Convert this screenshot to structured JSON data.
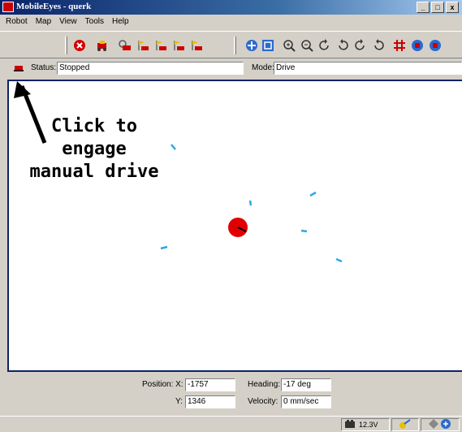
{
  "window": {
    "title": "MobileEyes - querk",
    "controls": [
      "_",
      "□",
      "x"
    ]
  },
  "menu": [
    "Robot",
    "Map",
    "View",
    "Tools",
    "Help"
  ],
  "toolbar": {
    "group1": [
      "stop-icon",
      "robot-drive-icon",
      "robot-goto-icon",
      "robot-goal-icon",
      "robot-goal-icon",
      "robot-goal-icon",
      "robot-goal-icon"
    ],
    "group2": [
      "center-icon",
      "zoom-fit-icon",
      "zoom-in-icon",
      "zoom-out-icon",
      "rotate-left-icon",
      "rotate-right-icon",
      "rotate-icon",
      "rotate-icon",
      "grid-icon",
      "robot-view-icon",
      "robot-view-icon"
    ]
  },
  "status": {
    "label": "Status:",
    "value": "Stopped",
    "mode_label": "Mode:",
    "mode_value": "Drive"
  },
  "annotation": {
    "lines": [
      "Click to",
      "engage",
      "manual drive"
    ]
  },
  "colors": {
    "robot": "#e00000",
    "laser_points": "#2aa9e6",
    "border": "#0a246a"
  },
  "position": {
    "x_label": "Position: X:",
    "x_value": "-1757",
    "y_label": "Y:",
    "y_value": "1346",
    "heading_label": "Heading:",
    "heading_value": "-17 deg",
    "velocity_label": "Velocity:",
    "velocity_value": "0 mm/sec"
  },
  "statusbar": {
    "battery": "12.3V"
  }
}
